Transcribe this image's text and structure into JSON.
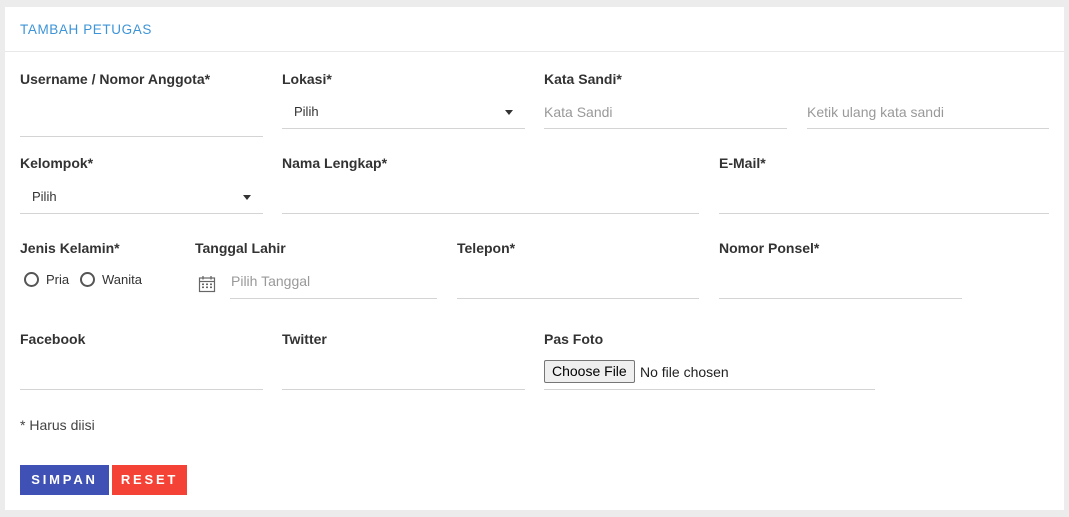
{
  "header": {
    "title": "TAMBAH PETUGAS"
  },
  "form": {
    "username": {
      "label": "Username / Nomor Anggota*",
      "value": ""
    },
    "lokasi": {
      "label": "Lokasi*",
      "selected": "Pilih"
    },
    "kata_sandi": {
      "label": "Kata Sandi*",
      "placeholder": "Kata Sandi",
      "confirm_placeholder": "Ketik ulang kata sandi"
    },
    "kelompok": {
      "label": "Kelompok*",
      "selected": "Pilih"
    },
    "nama_lengkap": {
      "label": "Nama Lengkap*",
      "value": ""
    },
    "email": {
      "label": "E-Mail*",
      "value": ""
    },
    "jenis_kelamin": {
      "label": "Jenis Kelamin*",
      "options": [
        "Pria",
        "Wanita"
      ]
    },
    "tanggal_lahir": {
      "label": "Tanggal Lahir",
      "placeholder": "Pilih Tanggal"
    },
    "telepon": {
      "label": "Telepon*",
      "value": ""
    },
    "nomor_ponsel": {
      "label": "Nomor Ponsel*",
      "value": ""
    },
    "facebook": {
      "label": "Facebook",
      "value": ""
    },
    "twitter": {
      "label": "Twitter",
      "value": ""
    },
    "pas_foto": {
      "label": "Pas Foto",
      "button": "Choose File",
      "status": "No file chosen"
    },
    "required_note": "* Harus diisi"
  },
  "actions": {
    "save_label": "SIMPAN",
    "reset_label": "RESET"
  },
  "colors": {
    "title": "#3d94d8",
    "save": "#3f51b5",
    "reset": "#f44336"
  }
}
